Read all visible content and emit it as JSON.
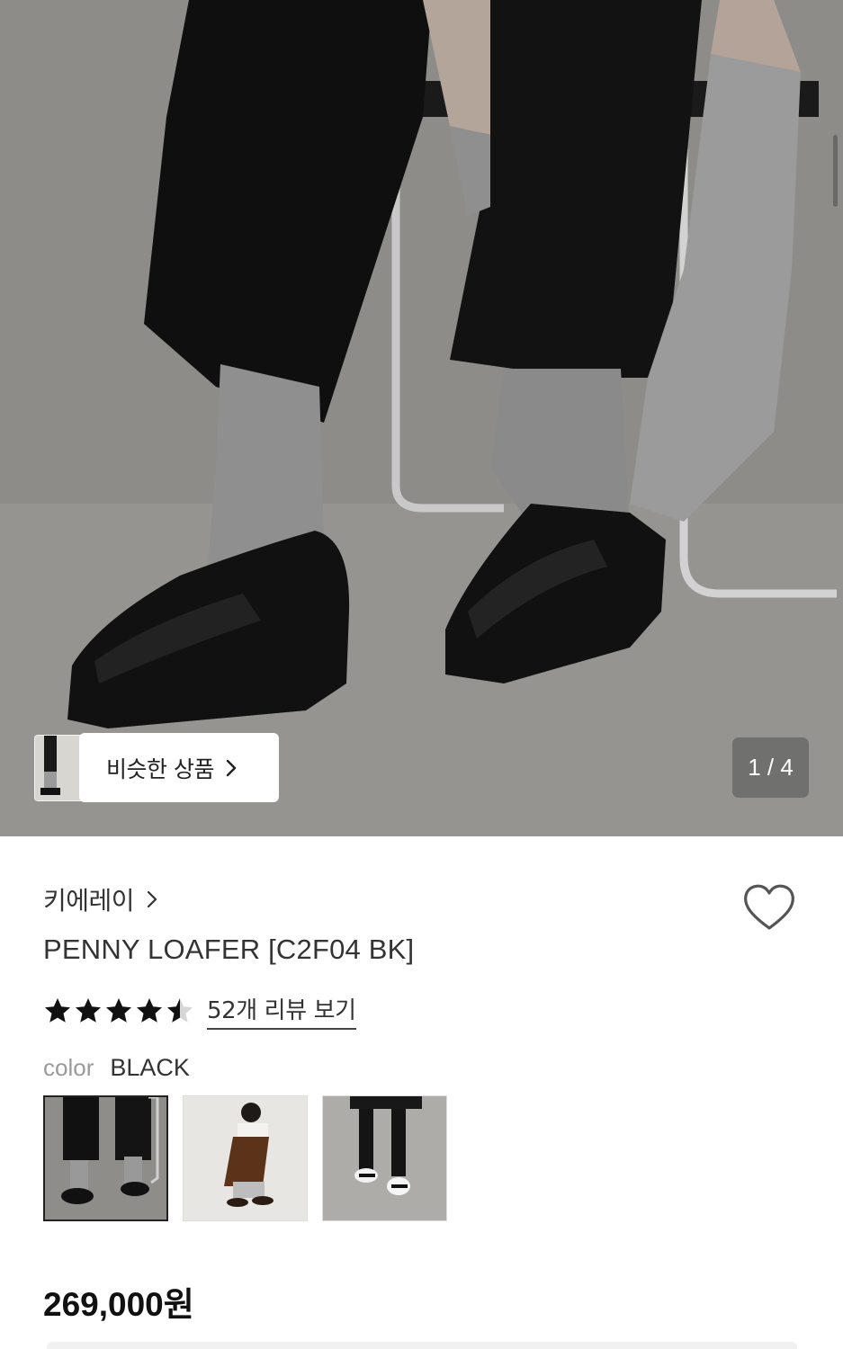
{
  "gallery": {
    "counter_text": "1 / 4",
    "similar_label": "비슷한 상품"
  },
  "product": {
    "brand": "키에레이",
    "title": "PENNY LOAFER [C2F04 BK]",
    "rating": 4.5,
    "rating_max": 5,
    "review_link": "52개 리뷰 보기",
    "color_label": "color",
    "color_value": "BLACK",
    "price": "269,000",
    "currency": "원"
  },
  "swatches": [
    {
      "name": "black-loafer-seated",
      "selected": true
    },
    {
      "name": "brown-loafer-crouched",
      "selected": false
    },
    {
      "name": "white-loafer-socks",
      "selected": false
    }
  ],
  "icons": {
    "heart": "heart-outline-icon",
    "brand_chevron": "chevron-right-icon",
    "similar_chevron": "chevron-right-icon",
    "star": "star-icon"
  },
  "colors": {
    "text_primary": "#222222",
    "text_muted": "#9a9a9a",
    "counter_bg": "#646464"
  }
}
